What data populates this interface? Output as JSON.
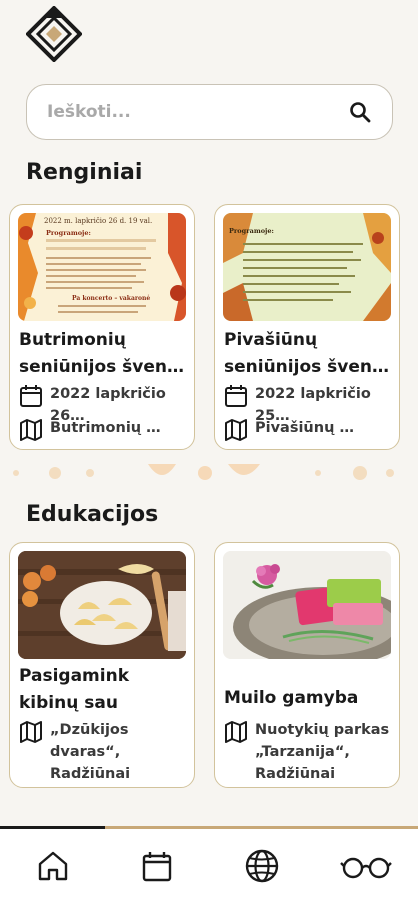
{
  "app": {
    "logo_icon": "diamond-logo-icon"
  },
  "search": {
    "placeholder": "Ieškoti...",
    "icon": "search-icon"
  },
  "events": {
    "title": "Renginiai",
    "cards": [
      {
        "title": "Butrimonių seniūnijos šven…",
        "date": "2022 lapkričio 26…",
        "location": "Butrimonių …"
      },
      {
        "title": "Pivašiūnų seniūnijos šven…",
        "date": "2022 lapkričio 25…",
        "location": "Pivašiūnų …"
      }
    ]
  },
  "education": {
    "title": "Edukacijos",
    "cards": [
      {
        "title": "Pasigamink kibinų sau",
        "location": "„Dzūkijos\ndvaras“,\nRadžiūnai"
      },
      {
        "title": "Muilo gamyba",
        "location": "Nuotykių parkas\n„Tarzanija“,\nRadžiūnai"
      }
    ]
  },
  "poster1": {
    "line1": "2022 m. lapkričio 26 d. 19 val.",
    "line2": "Programoje:",
    "line3": "Pa koncerto – vakaronė"
  },
  "poster2": {
    "line1": "Programoje:"
  },
  "bottom_nav": [
    "home-icon",
    "calendar-icon",
    "globe-icon",
    "glasses-icon"
  ],
  "colors": {
    "accent": "#c8a878",
    "card_border": "#d2c39c",
    "background": "#f7f5f1"
  }
}
